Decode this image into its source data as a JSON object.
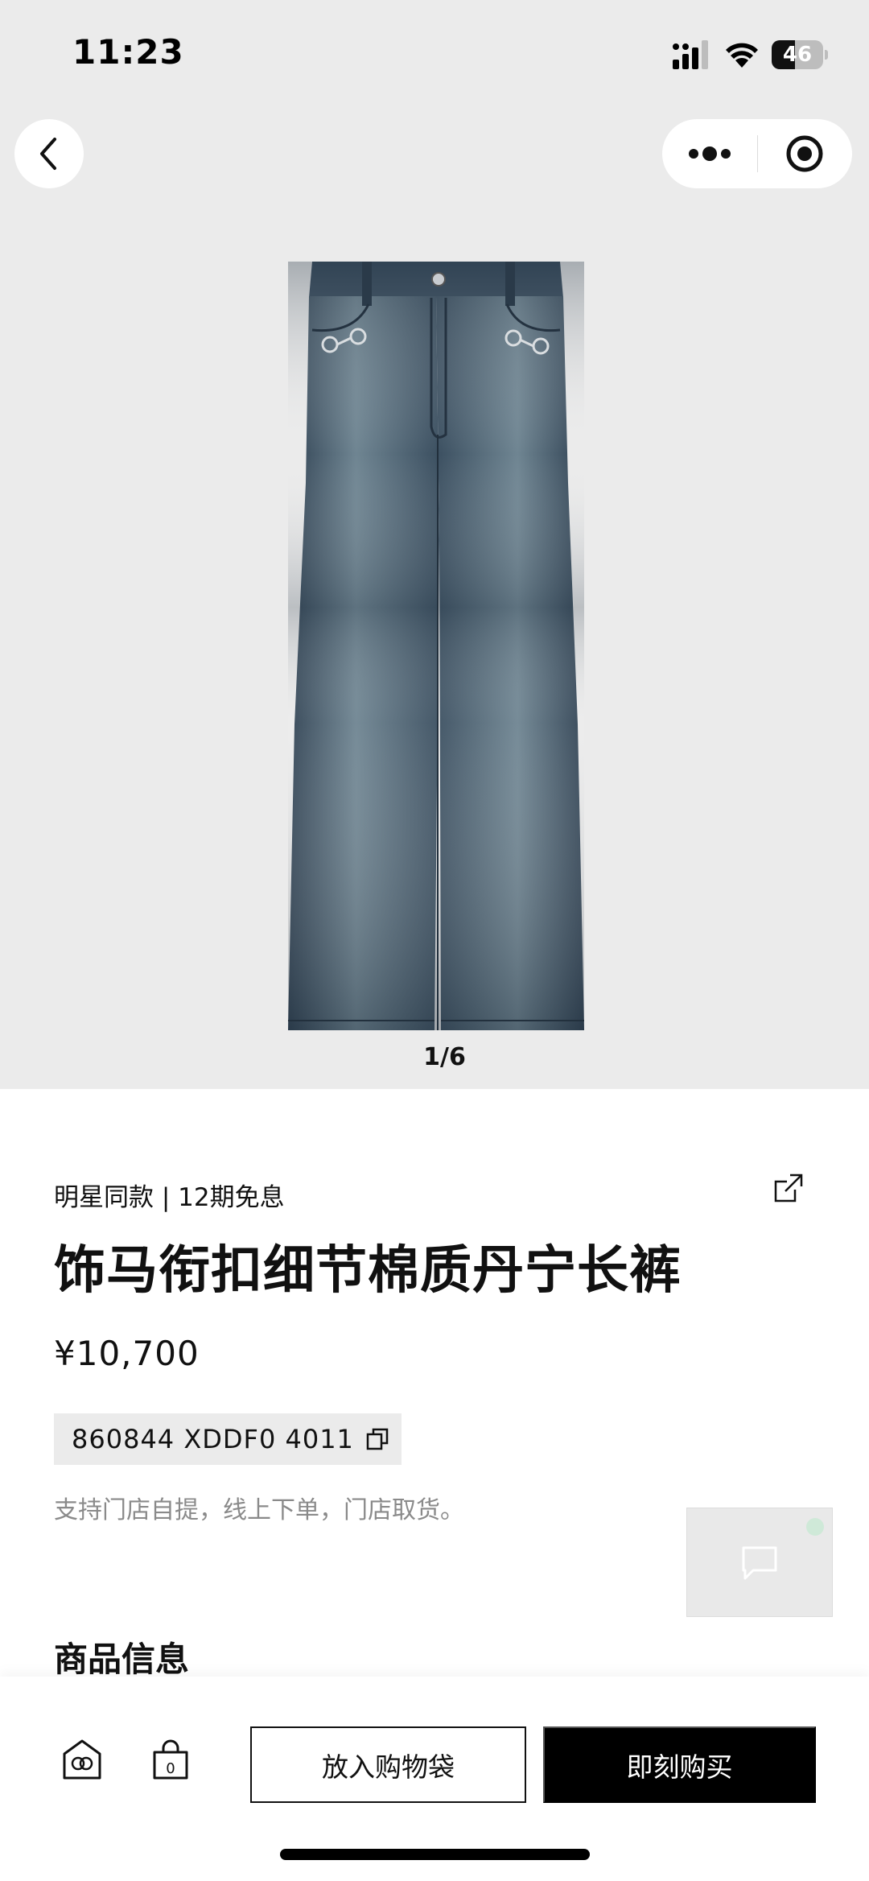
{
  "status_bar": {
    "time": "11:23",
    "battery": "46",
    "battery_level": 0.46,
    "icons": [
      "signal-icon",
      "wifi-icon",
      "battery-icon"
    ]
  },
  "nav": {
    "back_icon": "chevron-left-icon",
    "more_icon": "more-dots-icon",
    "close_icon": "target-close-icon"
  },
  "gallery": {
    "counter": "1/6",
    "image": "denim-jeans-photo"
  },
  "product": {
    "tags": "明星同款 | 12期免息",
    "title": "饰马衔扣细节棉质丹宁长裤",
    "price": "¥10,700",
    "sku": "860844 XDDF0 4011",
    "pickup_note": "支持门店自提，线上下单，门店取货。",
    "share_icon": "share-icon",
    "copy_icon": "copy-icon"
  },
  "section": {
    "title": "商品信息"
  },
  "chat": {
    "icon": "chat-bubble-icon"
  },
  "bottom_bar": {
    "store_icon": "store-logo-icon",
    "bag_icon": "shopping-bag-icon",
    "bag_count": "0",
    "add_to_bag": "放入购物袋",
    "buy_now": "即刻购买"
  },
  "colors": {
    "hero_bg": "#ebebeb",
    "primary": "#000000",
    "muted_text": "#8a8a8a"
  }
}
